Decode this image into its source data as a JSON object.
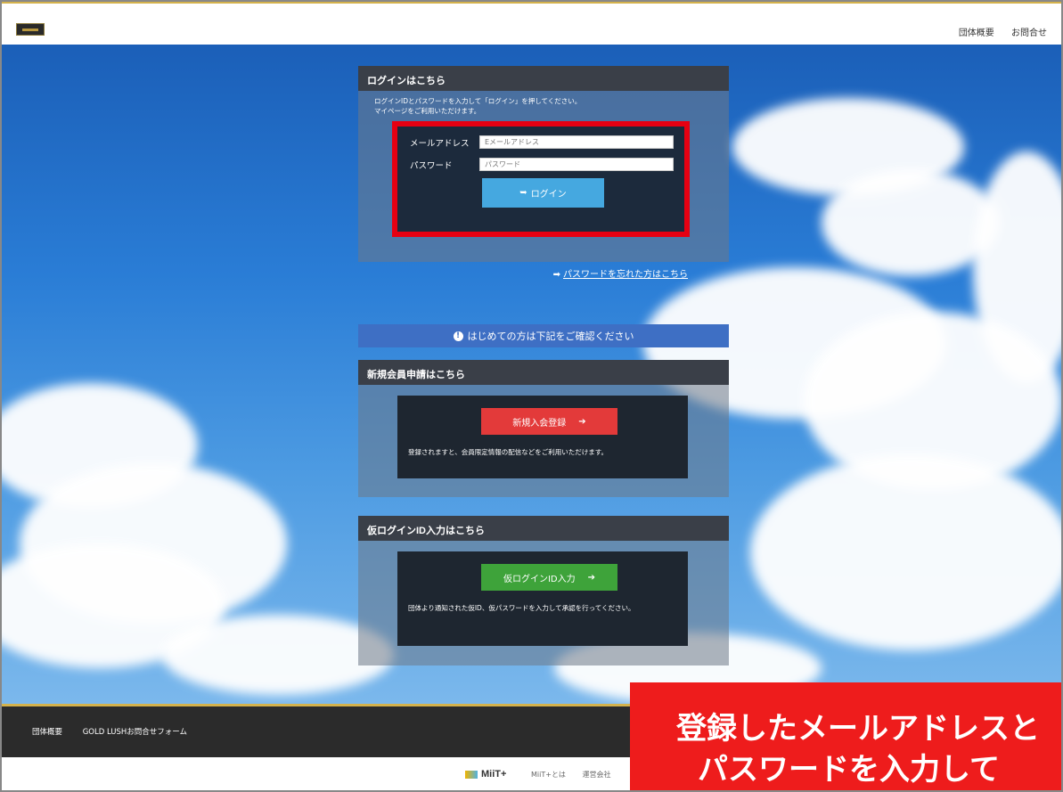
{
  "header": {
    "nav": [
      "団体概要",
      "お問合せ"
    ]
  },
  "login": {
    "title": "ログインはこちら",
    "description_line1": "ログインIDとパスワードを入力して「ログイン」を押してください。",
    "description_line2": "マイページをご利用いただけます。",
    "email_label": "メールアドレス",
    "email_placeholder": "Eメールアドレス",
    "password_label": "パスワード",
    "password_placeholder": "パスワード",
    "login_button": "ログイン",
    "forgot_link": "パスワードを忘れた方はこちら"
  },
  "notice": {
    "text": "はじめての方は下記をご確認ください"
  },
  "register": {
    "title": "新規会員申請はこちら",
    "button": "新規入会登録",
    "description": "登録されますと、会員限定情報の配信などをご利用いただけます。"
  },
  "temp_login": {
    "title": "仮ログインID入力はこちら",
    "button": "仮ログインID入力",
    "description": "団体より通知された仮ID、仮パスワードを入力して承認を行ってください。"
  },
  "footer": {
    "links": [
      "団体概要",
      "GOLD LUSHお問合せフォーム"
    ]
  },
  "bottombar": {
    "brand": "MiiT+",
    "links": [
      "MiiT+とは",
      "運営会社"
    ]
  },
  "banner": {
    "line1": "登録したメールアドレスと",
    "line2": "パスワードを入力して"
  },
  "colors": {
    "accent_red": "#e60012",
    "login_button": "#45a8e0",
    "register_button": "#e33a3a",
    "temp_button": "#3ea33a",
    "gold": "#d4b24c"
  }
}
